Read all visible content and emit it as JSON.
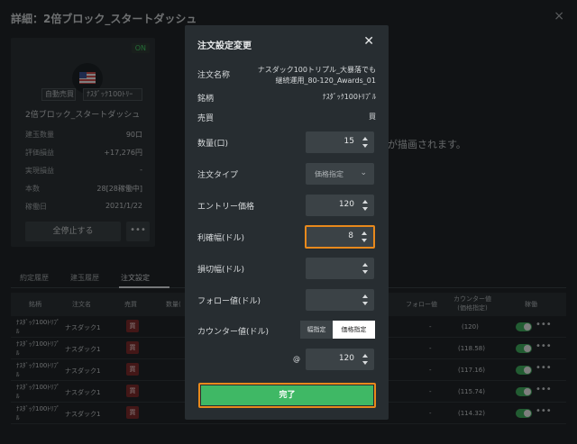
{
  "background": {
    "title": "詳細：2倍ブロック_スタートダッシュ",
    "close": "×",
    "card": {
      "status": "ON",
      "tag_auto": "自動売買",
      "tag_symbol": "ﾅｽﾀﾞｯｸ100ﾄﾘｰ",
      "name": "2倍ブロック_スタートダッシュ",
      "rows": [
        {
          "label": "建玉数量",
          "value": "90口"
        },
        {
          "label": "評価損益",
          "value": "+17,276円"
        },
        {
          "label": "実現損益",
          "value": "-"
        },
        {
          "label": "本数",
          "value": "28[28稼働中]"
        },
        {
          "label": "稼働日",
          "value": "2021/1/22"
        }
      ],
      "stop_all": "全停止する",
      "more": "•••"
    },
    "message_fragment": "が描画されます。",
    "tabs": [
      "約定履歴",
      "建玉履歴",
      "注文設定"
    ],
    "table": {
      "headers": [
        "銘柄",
        "注文名",
        "売買",
        "数量(",
        "フォロー値",
        "カウンター値(価格指定)",
        "稼働"
      ],
      "rows": [
        {
          "symbol": "ﾅｽﾀﾞｯｸ100ﾄﾘﾌﾟﾙ",
          "name": "ナスダック1",
          "side": "買",
          "follow": "-",
          "counter": "(120)"
        },
        {
          "symbol": "ﾅｽﾀﾞｯｸ100ﾄﾘﾌﾟﾙ",
          "name": "ナスダック1",
          "side": "買",
          "follow": "-",
          "counter": "(118.58)"
        },
        {
          "symbol": "ﾅｽﾀﾞｯｸ100ﾄﾘﾌﾟﾙ",
          "name": "ナスダック1",
          "side": "買",
          "follow": "-",
          "counter": "(117.16)"
        },
        {
          "symbol": "ﾅｽﾀﾞｯｸ100ﾄﾘﾌﾟﾙ",
          "name": "ナスダック1",
          "side": "買",
          "follow": "-",
          "counter": "(115.74)"
        },
        {
          "symbol": "ﾅｽﾀﾞｯｸ100ﾄﾘﾌﾟﾙ",
          "name": "ナスダック1",
          "side": "買",
          "follow": "-",
          "counter": "(114.32)"
        }
      ]
    }
  },
  "modal": {
    "title": "注文設定変更",
    "close": "✕",
    "order_name_label": "注文名称",
    "order_name_line1": "ナスダック100トリプル_大暴落でも",
    "order_name_line2": "継続運用_80-120_Awards_01",
    "symbol_label": "銘柄",
    "symbol_value": "ﾅｽﾀﾞｯｸ100ﾄﾘﾌﾟﾙ",
    "side_label": "売買",
    "side_value": "買",
    "quantity_label": "数量(口)",
    "quantity_value": "15",
    "order_type_label": "注文タイプ",
    "order_type_value": "価格指定",
    "entry_label": "エントリー価格",
    "entry_value": "120",
    "profit_label": "利確幅(ドル)",
    "profit_value": "8",
    "stop_label": "損切幅(ドル)",
    "stop_value": "",
    "follow_label": "フォロー値(ドル)",
    "follow_value": "",
    "counter_label": "カウンター値(ドル)",
    "counter_option_width": "幅指定",
    "counter_option_price": "価格指定",
    "at_symbol": "@",
    "counter_value": "120",
    "done_label": "完了"
  },
  "colors": {
    "accent_green": "#3fb865",
    "focus_orange": "#e8891c",
    "modal_bg": "#272d31",
    "field_bg": "#3b4246"
  }
}
